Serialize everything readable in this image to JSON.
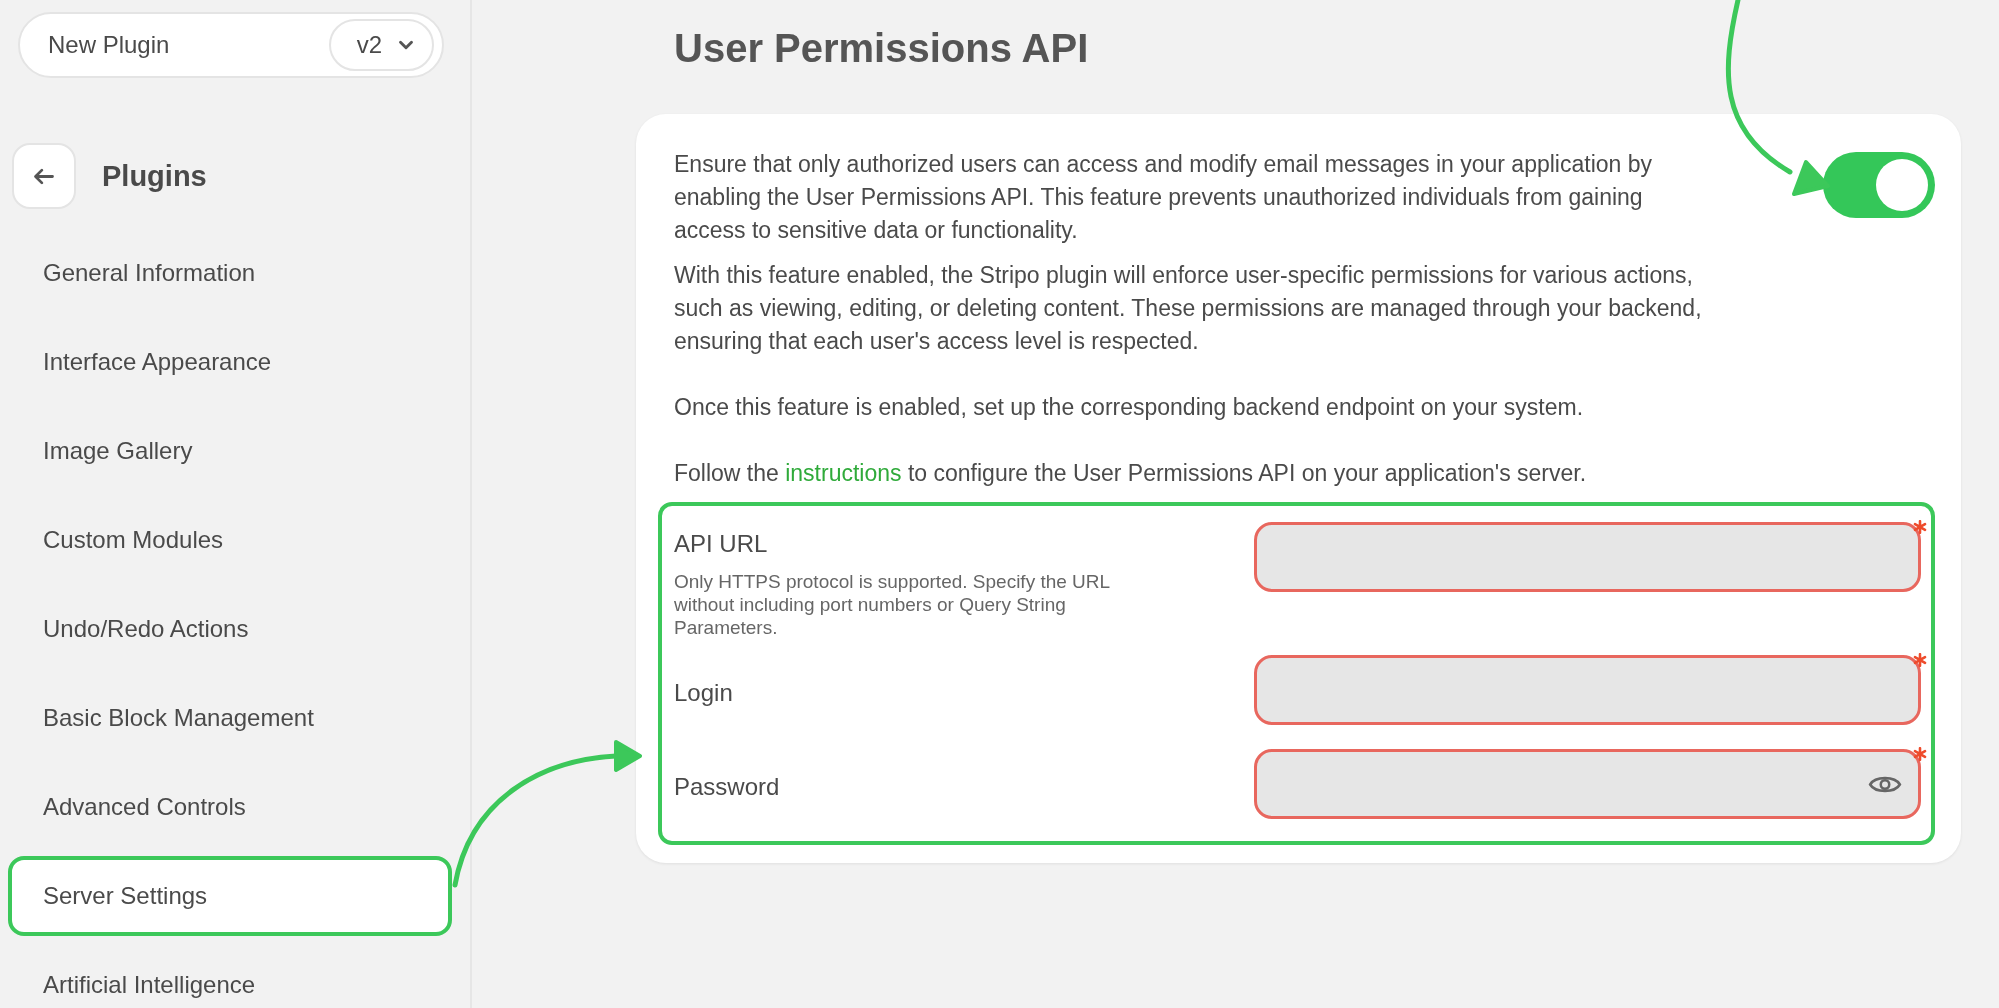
{
  "plugin_selector": {
    "name": "New Plugin",
    "version": "v2"
  },
  "sidebar": {
    "back_title": "Plugins",
    "items": [
      {
        "label": "General Information",
        "selected": false,
        "highlighted": false
      },
      {
        "label": "Interface Appearance",
        "selected": false,
        "highlighted": false
      },
      {
        "label": "Image Gallery",
        "selected": false,
        "highlighted": false
      },
      {
        "label": "Custom Modules",
        "selected": false,
        "highlighted": false
      },
      {
        "label": "Undo/Redo Actions",
        "selected": false,
        "highlighted": false
      },
      {
        "label": "Basic Block Management",
        "selected": false,
        "highlighted": false
      },
      {
        "label": "Advanced Controls",
        "selected": false,
        "highlighted": false
      },
      {
        "label": "Server Settings",
        "selected": true,
        "highlighted": true
      },
      {
        "label": "Artificial Intelligence",
        "selected": false,
        "highlighted": false
      }
    ]
  },
  "page_title": "User Permissions API",
  "card": {
    "toggle_on": true,
    "paragraphs": [
      "Ensure that only authorized users can access and modify email messages in your application by enabling the User Permissions API. This feature prevents unauthorized individuals from gaining access to sensitive data or functionality.",
      "With this feature enabled, the Stripo plugin will enforce user-specific permissions for various actions, such as viewing, editing, or deleting content. These permissions are managed through your backend, ensuring that each user's access level is respected.",
      "Once this feature is enabled, set up the corresponding backend endpoint on your system."
    ],
    "follow": {
      "before": "Follow the ",
      "link": "instructions",
      "after": " to configure the User Permissions API on your application's server."
    },
    "credentials": {
      "highlighted": true,
      "fields": [
        {
          "label": "API URL",
          "hint": "Only HTTPS protocol is supported. Specify the URL without including port numbers or Query String Parameters.",
          "kind": "text",
          "required": true,
          "invalid": true
        },
        {
          "label": "Login",
          "kind": "text",
          "required": true,
          "invalid": true
        },
        {
          "label": "Password",
          "kind": "password",
          "required": true,
          "invalid": true
        }
      ]
    }
  }
}
